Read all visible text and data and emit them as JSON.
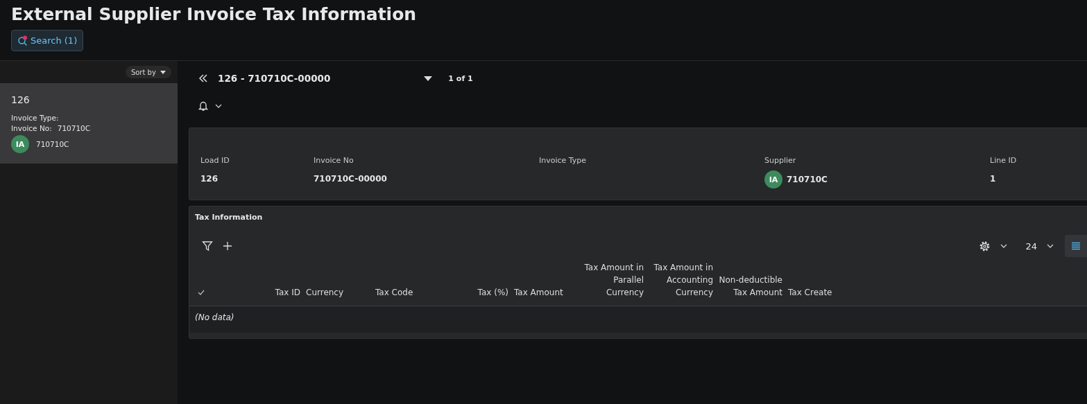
{
  "page_title": "External Supplier Invoice Tax Information",
  "search_button": {
    "label": "Search (1)",
    "filter_active": true
  },
  "sidebar": {
    "sort_label": "Sort by",
    "items": [
      {
        "title": "126",
        "fields": [
          {
            "label": "Invoice Type:"
          },
          {
            "label": "Invoice No:",
            "value": "710710C"
          }
        ],
        "avatar": "IA",
        "owner": "710710C",
        "selected": true
      }
    ]
  },
  "record_nav": {
    "title": "126 - 710710C-00000",
    "counter": "1 of 1"
  },
  "header_fields": [
    {
      "label": "Load ID",
      "value": "126"
    },
    {
      "label": "Invoice No",
      "value": "710710C-00000"
    },
    {
      "label": "Invoice Type"
    },
    {
      "label": "Supplier",
      "value": "710710C",
      "avatar": "IA"
    },
    {
      "label": "Line ID",
      "value": "1"
    }
  ],
  "tax_section": {
    "title": "Tax Information",
    "page_size": "24",
    "columns": [
      {
        "label": "Tax ID",
        "kind": "numeric"
      },
      {
        "label": "Currency",
        "kind": "text"
      },
      {
        "label": "Tax Code",
        "kind": "text"
      },
      {
        "label": "Tax (%)",
        "kind": "numeric"
      },
      {
        "label": "Tax Amount",
        "kind": "text"
      },
      {
        "label": "Tax Amount in Parallel Currency",
        "kind": "numeric"
      },
      {
        "label": "Tax Amount in Accounting Currency",
        "kind": "numeric"
      },
      {
        "label": "Non-deductible Tax Amount",
        "kind": "numeric"
      },
      {
        "label": "Tax Create",
        "kind": "text"
      }
    ],
    "empty_text": "(No data)"
  }
}
